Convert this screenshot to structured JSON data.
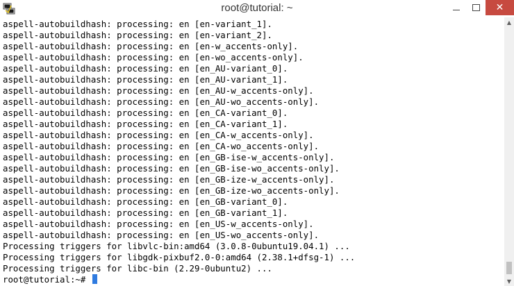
{
  "window": {
    "title": "root@tutorial: ~",
    "minimize_icon": "minimize-icon",
    "maximize_icon": "maximize-icon",
    "close_icon": "close-icon",
    "close_glyph": "✕"
  },
  "terminal": {
    "lines": [
      "aspell-autobuildhash: processing: en [en-variant_1].",
      "aspell-autobuildhash: processing: en [en-variant_2].",
      "aspell-autobuildhash: processing: en [en-w_accents-only].",
      "aspell-autobuildhash: processing: en [en-wo_accents-only].",
      "aspell-autobuildhash: processing: en [en_AU-variant_0].",
      "aspell-autobuildhash: processing: en [en_AU-variant_1].",
      "aspell-autobuildhash: processing: en [en_AU-w_accents-only].",
      "aspell-autobuildhash: processing: en [en_AU-wo_accents-only].",
      "aspell-autobuildhash: processing: en [en_CA-variant_0].",
      "aspell-autobuildhash: processing: en [en_CA-variant_1].",
      "aspell-autobuildhash: processing: en [en_CA-w_accents-only].",
      "aspell-autobuildhash: processing: en [en_CA-wo_accents-only].",
      "aspell-autobuildhash: processing: en [en_GB-ise-w_accents-only].",
      "aspell-autobuildhash: processing: en [en_GB-ise-wo_accents-only].",
      "aspell-autobuildhash: processing: en [en_GB-ize-w_accents-only].",
      "aspell-autobuildhash: processing: en [en_GB-ize-wo_accents-only].",
      "aspell-autobuildhash: processing: en [en_GB-variant_0].",
      "aspell-autobuildhash: processing: en [en_GB-variant_1].",
      "aspell-autobuildhash: processing: en [en_US-w_accents-only].",
      "aspell-autobuildhash: processing: en [en_US-wo_accents-only].",
      "Processing triggers for libvlc-bin:amd64 (3.0.8-0ubuntu19.04.1) ...",
      "Processing triggers for libgdk-pixbuf2.0-0:amd64 (2.38.1+dfsg-1) ...",
      "Processing triggers for libc-bin (2.29-0ubuntu2) ..."
    ],
    "prompt": "root@tutorial:~# ",
    "cursor_color": "#2f7be0"
  },
  "scrollbar": {
    "up_glyph": "▲",
    "down_glyph": "▼"
  }
}
